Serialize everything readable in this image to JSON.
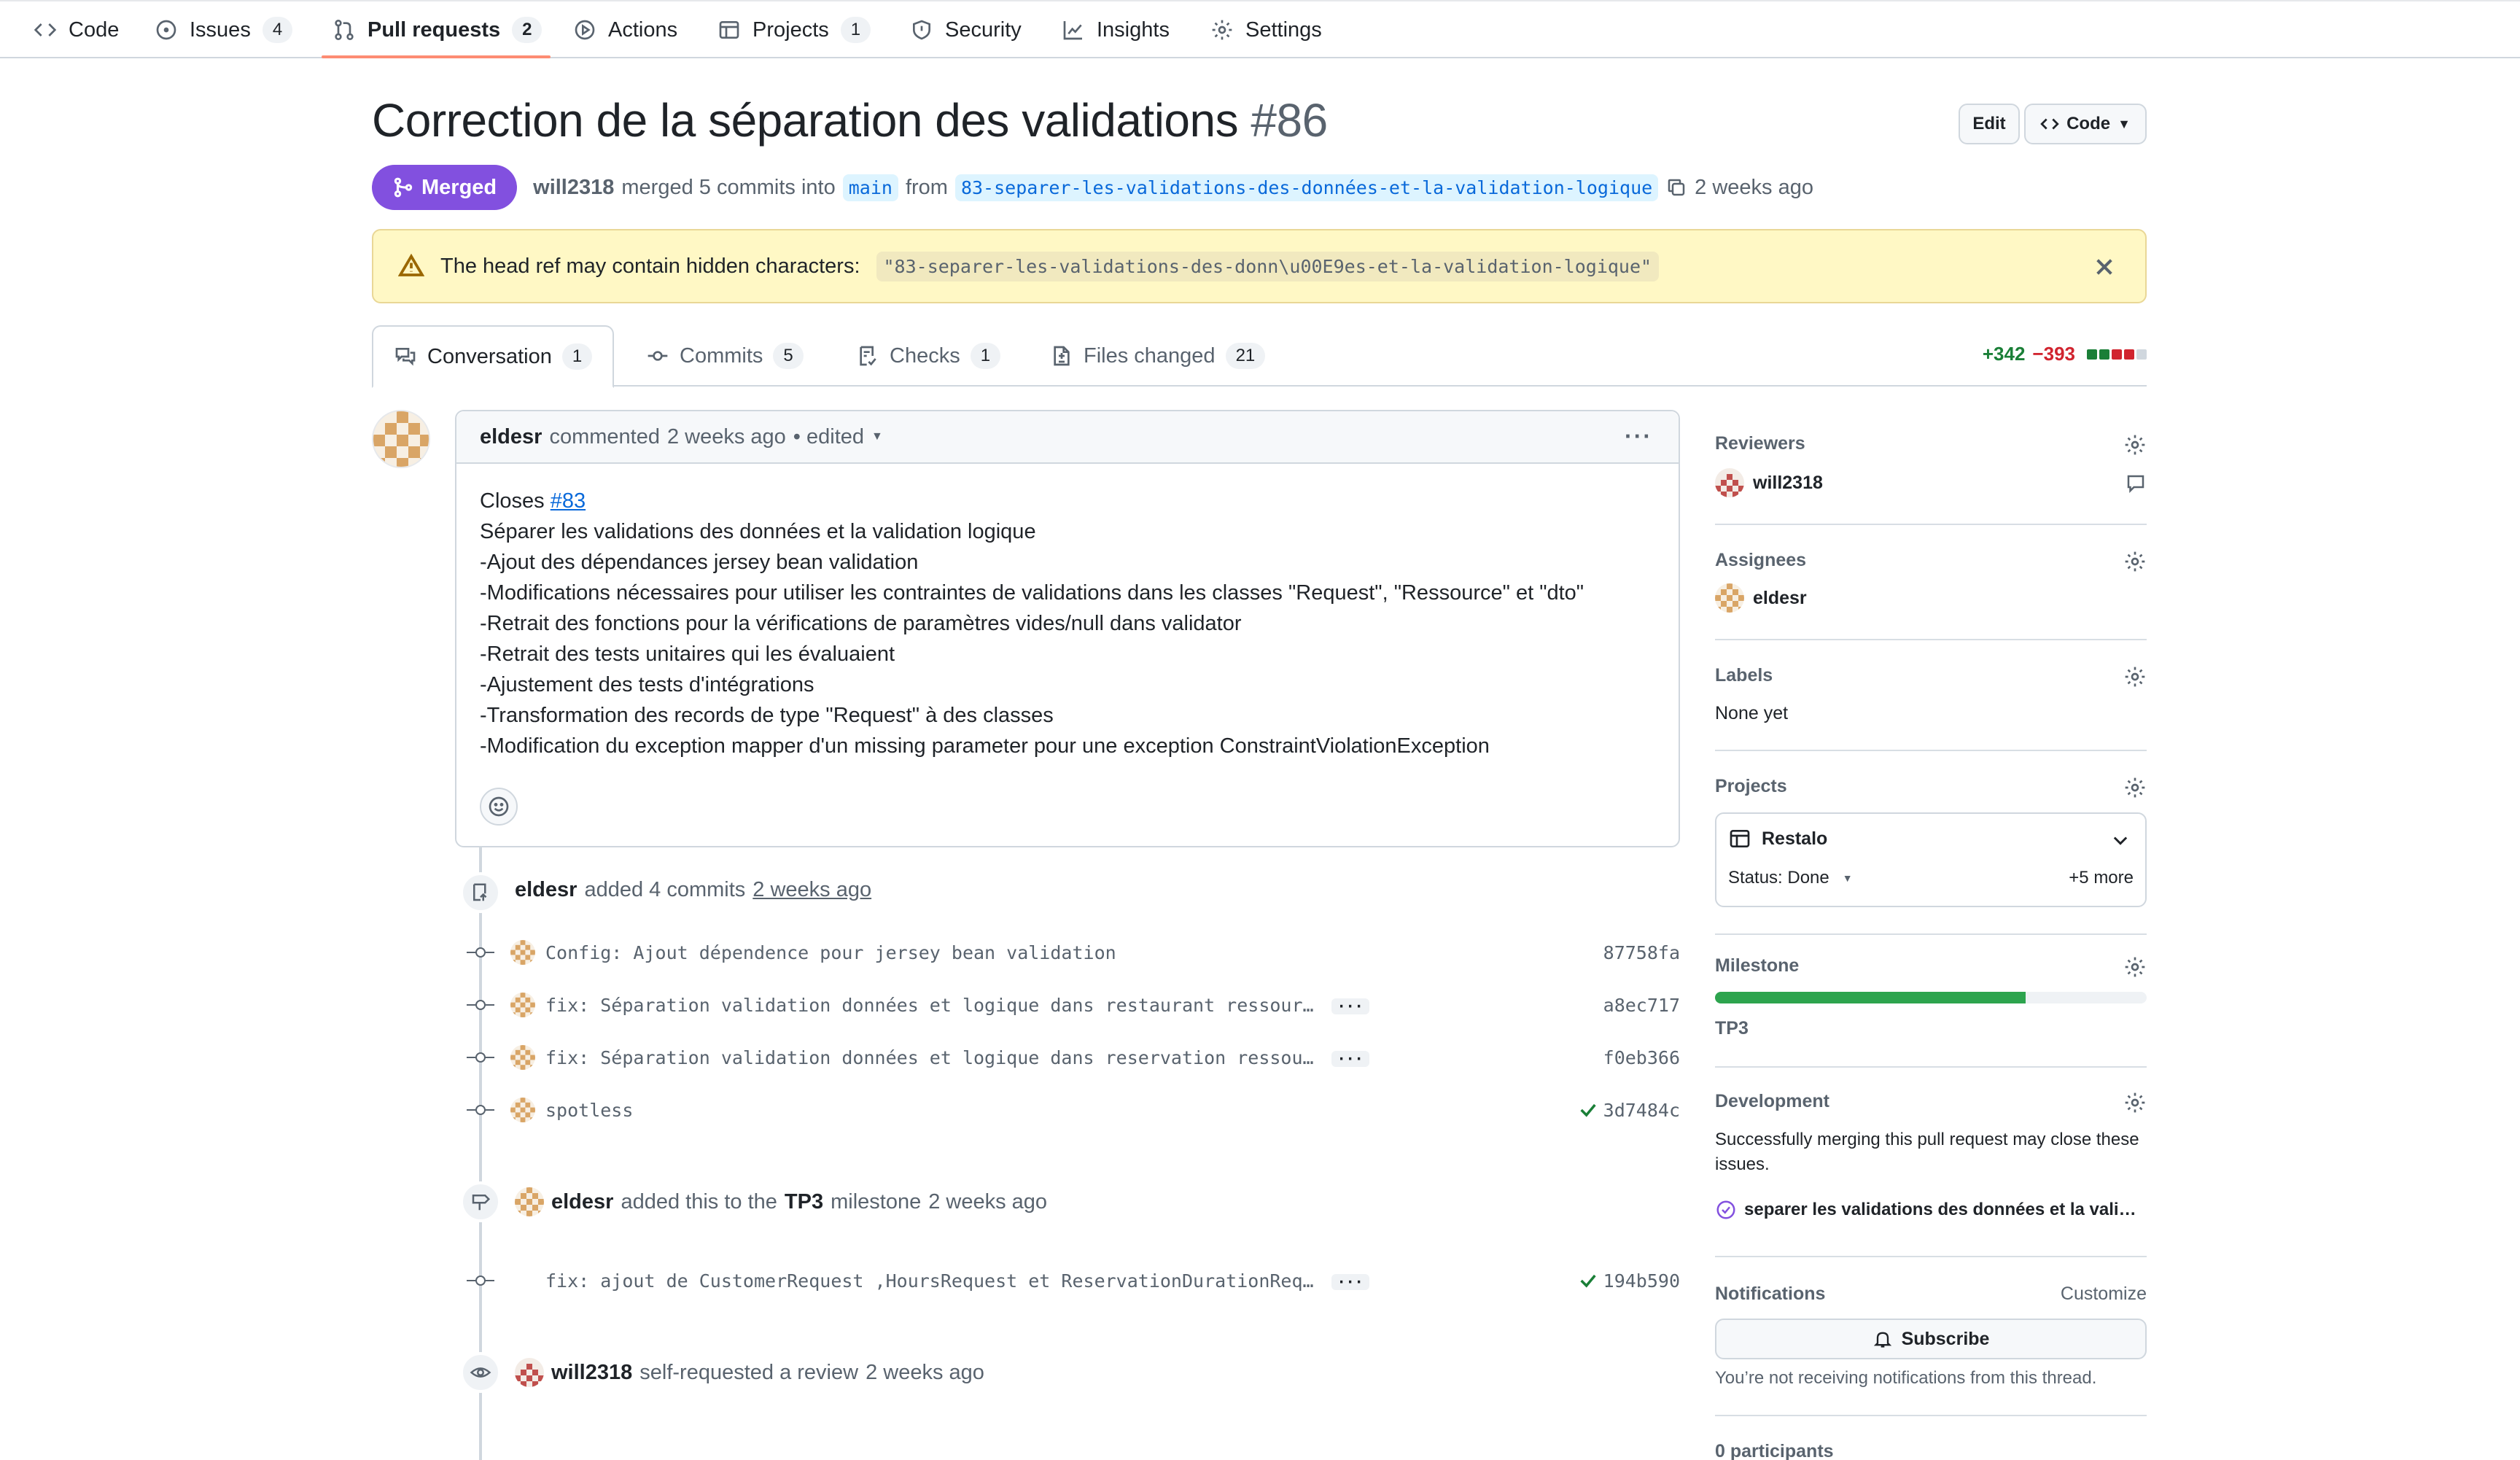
{
  "nav": {
    "items": [
      {
        "label": "Code",
        "icon": "code-icon",
        "count": null
      },
      {
        "label": "Issues",
        "icon": "issue-icon",
        "count": "4"
      },
      {
        "label": "Pull requests",
        "icon": "pull-request-icon",
        "count": "2"
      },
      {
        "label": "Actions",
        "icon": "play-icon",
        "count": null
      },
      {
        "label": "Projects",
        "icon": "table-icon",
        "count": "1"
      },
      {
        "label": "Security",
        "icon": "shield-icon",
        "count": null
      },
      {
        "label": "Insights",
        "icon": "graph-icon",
        "count": null
      },
      {
        "label": "Settings",
        "icon": "gear-icon",
        "count": null
      }
    ],
    "active": "Pull requests",
    "accent": "#fd8c73"
  },
  "pr": {
    "title": "Correction de la séparation des validations",
    "number": "#86",
    "edit_label": "Edit",
    "code_label": "Code",
    "state": "Merged",
    "state_color": "#8250df",
    "author": "will2318",
    "merged_text": "merged 5 commits into",
    "base_branch": "main",
    "from_text": "from",
    "head_branch": "83-separer-les-validations-des-données-et-la-validation-logique",
    "time": "2 weeks ago"
  },
  "warning": {
    "text": "The head ref may contain hidden characters:",
    "ref": "\"83-separer-les-validations-des-donn\\u00E9es-et-la-validation-logique\""
  },
  "tabs": [
    {
      "label": "Conversation",
      "count": "1",
      "icon": "comment-discussion-icon"
    },
    {
      "label": "Commits",
      "count": "5",
      "icon": "commit-icon"
    },
    {
      "label": "Checks",
      "count": "1",
      "icon": "checklist-icon"
    },
    {
      "label": "Files changed",
      "count": "21",
      "icon": "file-diff-icon"
    }
  ],
  "diffstat": {
    "additions": "+342",
    "deletions": "−393",
    "add_color": "#1a7f37",
    "del_color": "#d1242f"
  },
  "comment": {
    "author": "eldesr",
    "action": "commented",
    "time": "2 weeks ago",
    "edited": "• edited",
    "closes_prefix": "Closes",
    "closes_link": "#83",
    "lines": [
      "Séparer les validations des données et la validation logique",
      "-Ajout des dépendances jersey bean validation",
      "-Modifications nécessaires pour utiliser les contraintes de validations dans les classes \"Request\", \"Ressource\" et \"dto\"",
      "-Retrait des fonctions pour la vérifications de paramètres vides/null dans validator",
      "-Retrait des tests unitaires qui les évaluaient",
      "-Ajustement des tests d'intégrations",
      "-Transformation des records de type \"Request\" à des classes",
      "-Modification du exception mapper d'un missing parameter pour une exception ConstraintViolationException"
    ]
  },
  "timeline": {
    "commits_event": {
      "author": "eldesr",
      "text": "added 4 commits",
      "time": "2 weeks ago"
    },
    "commits": [
      {
        "message": "Config: Ajout dépendence pour jersey bean validation",
        "sha": "87758fa",
        "more": false,
        "check": false
      },
      {
        "message": "fix: Séparation validation données et logique dans restaurant ressour…",
        "sha": "a8ec717",
        "more": true,
        "check": false
      },
      {
        "message": "fix: Séparation validation données et logique dans reservation ressou…",
        "sha": "f0eb366",
        "more": true,
        "check": false
      },
      {
        "message": "spotless",
        "sha": "3d7484c",
        "more": false,
        "check": true
      }
    ],
    "milestone_event": {
      "author": "eldesr",
      "text": "added this to the",
      "milestone": "TP3",
      "suffix": "milestone",
      "time": "2 weeks ago"
    },
    "late_commit": {
      "message": "fix: ajout de CustomerRequest ,HoursRequest et ReservationDurationReq…",
      "sha": "194b590",
      "more": true,
      "check": true
    },
    "review_event": {
      "author": "will2318",
      "text": "self-requested a review",
      "time": "2 weeks ago"
    }
  },
  "sidebar": {
    "reviewers": {
      "heading": "Reviewers",
      "user": "will2318"
    },
    "assignees": {
      "heading": "Assignees",
      "user": "eldesr"
    },
    "labels": {
      "heading": "Labels",
      "value": "None yet"
    },
    "projects": {
      "heading": "Projects",
      "name": "Restalo",
      "status": "Status: Done",
      "more": "+5 more"
    },
    "milestone": {
      "heading": "Milestone",
      "name": "TP3",
      "progress": 0.72
    },
    "development": {
      "heading": "Development",
      "text": "Successfully merging this pull request may close these issues.",
      "issue": "separer les validations des données et la vali…"
    },
    "notifications": {
      "heading": "Notifications",
      "customize": "Customize",
      "subscribe": "Subscribe",
      "note": "You’re not receiving notifications from this thread."
    },
    "participants": {
      "heading": "0 participants"
    }
  }
}
